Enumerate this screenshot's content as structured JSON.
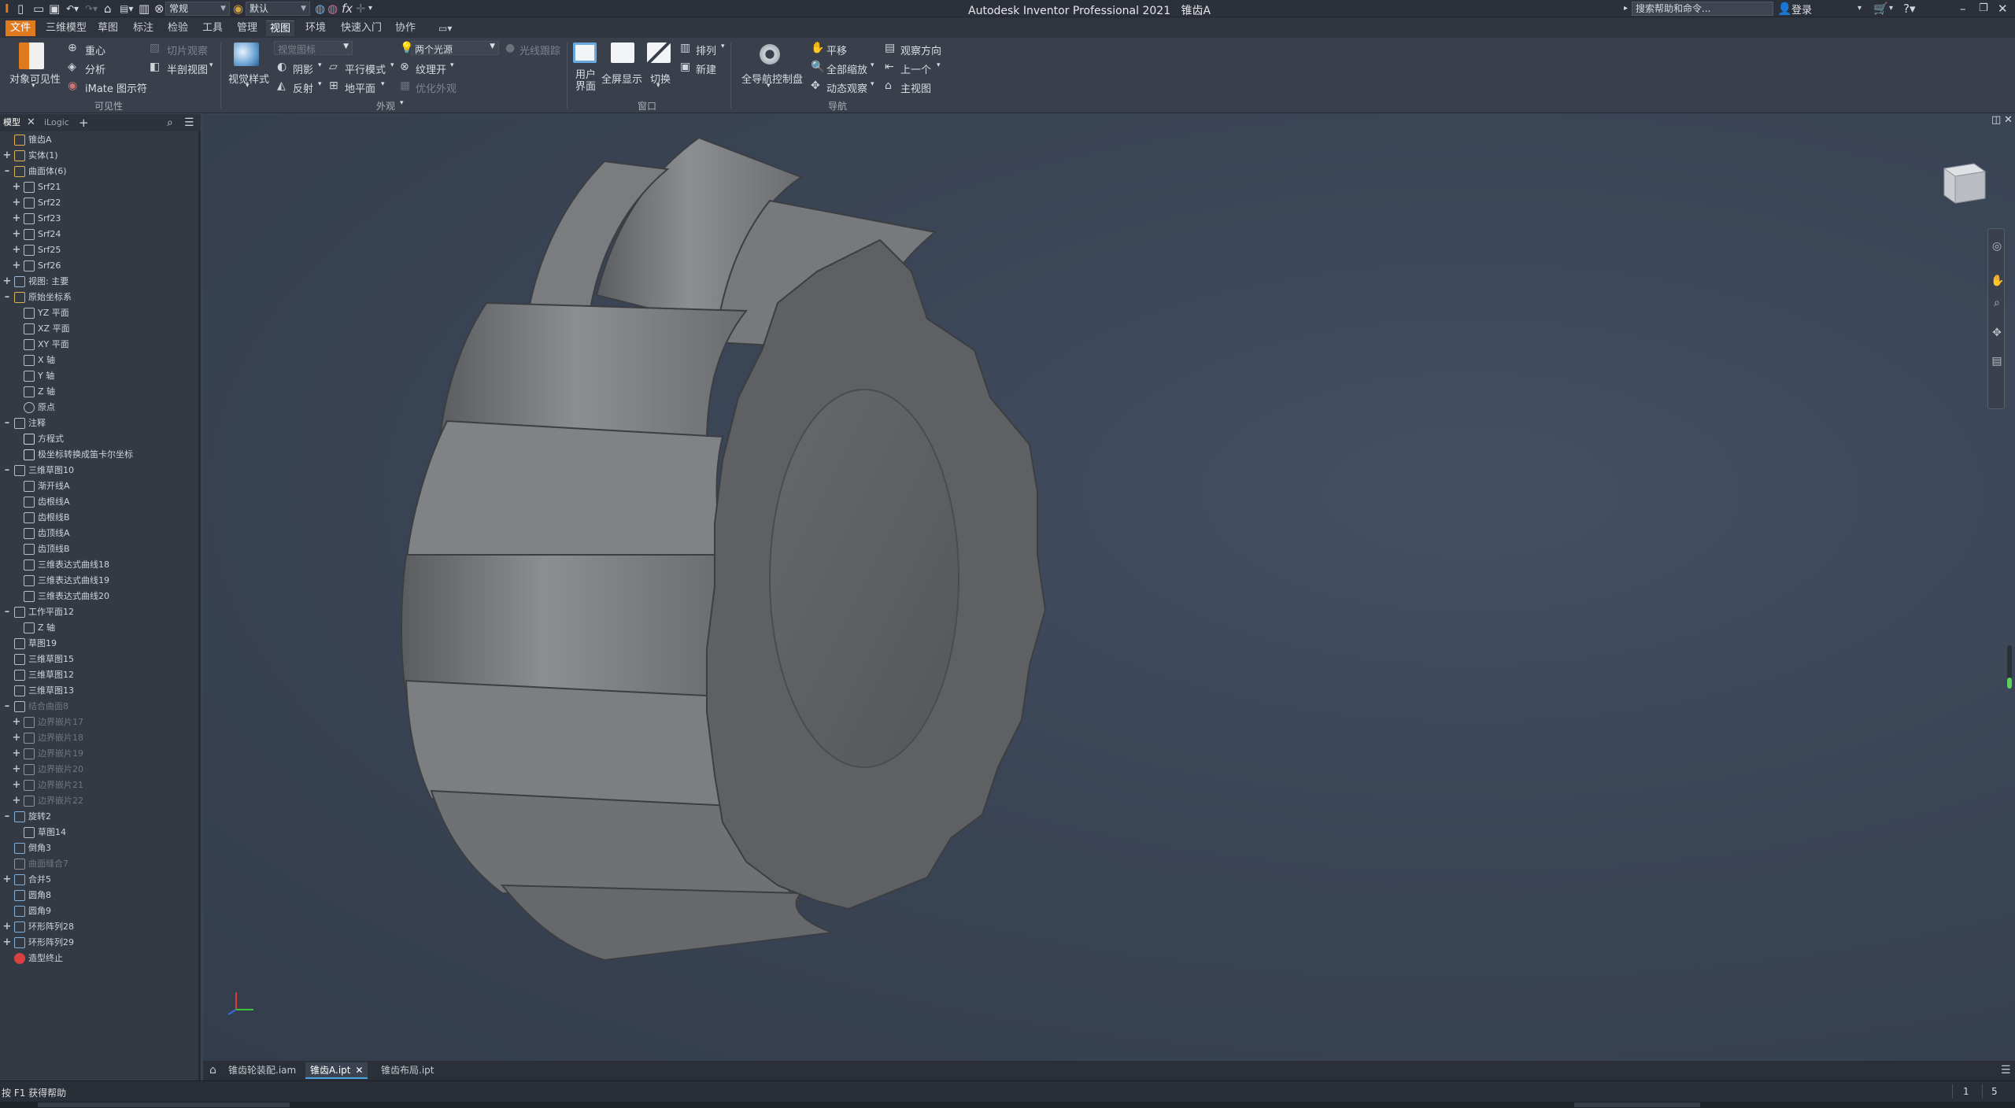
{
  "titlebar": {
    "app_title": "Autodesk Inventor Professional 2021",
    "doc_title": "锥齿A",
    "appearance_combo": "常规",
    "material_combo": "默认",
    "search_placeholder": "搜索帮助和命令...",
    "sign_in": "登录"
  },
  "menu_tabs": [
    "文件",
    "三维模型",
    "草图",
    "标注",
    "检验",
    "工具",
    "管理",
    "视图",
    "环境",
    "快速入门",
    "协作"
  ],
  "ribbon": {
    "visibility": {
      "object_visibility": "对象可见性",
      "center_of_gravity": "重心",
      "analysis": "分析",
      "imate_glyph": "iMate 图示符",
      "slice_graphics": "切片观察",
      "half_section": "半剖视图",
      "group_label": "可见性"
    },
    "appearance": {
      "visual_style": "视觉样式",
      "shadows": "阴影",
      "reflections": "反射",
      "parallel_mode": "平行模式",
      "ground_plane": "地平面",
      "two_lights": "两个光源",
      "textures_on": "纹理开",
      "ray_tracing": "光线跟踪",
      "optimize_appearance": "优化外观",
      "style_combo": "视觉图标",
      "group_label": "外观"
    },
    "windows": {
      "user_interface": "用户界面",
      "full_screen": "全屏显示",
      "switch": "切换",
      "arrange": "排列",
      "new": "新建",
      "group_label": "窗口"
    },
    "navigate": {
      "full_nav_wheel": "全导航控制盘",
      "pan": "平移",
      "zoom_all": "全部缩放",
      "orbit": "动态观察",
      "look_at": "观察方向",
      "previous": "上一个",
      "home_view": "主视图",
      "group_label": "导航"
    }
  },
  "browser": {
    "tab_model": "模型",
    "tab_ilogic": "iLogic",
    "items": [
      {
        "label": "锥齿A",
        "indent": 0,
        "exp": "",
        "icon": "part",
        "dim": false
      },
      {
        "label": "实体(1)",
        "indent": 0,
        "exp": "+",
        "icon": "folder",
        "dim": false
      },
      {
        "label": "曲面体(6)",
        "indent": 0,
        "exp": "-",
        "icon": "folder",
        "dim": false
      },
      {
        "label": "Srf21",
        "indent": 1,
        "exp": "+",
        "icon": "surface",
        "dim": false
      },
      {
        "label": "Srf22",
        "indent": 1,
        "exp": "+",
        "icon": "surface",
        "dim": false
      },
      {
        "label": "Srf23",
        "indent": 1,
        "exp": "+",
        "icon": "surface",
        "dim": false
      },
      {
        "label": "Srf24",
        "indent": 1,
        "exp": "+",
        "icon": "surface",
        "dim": false
      },
      {
        "label": "Srf25",
        "indent": 1,
        "exp": "+",
        "icon": "surface",
        "dim": false
      },
      {
        "label": "Srf26",
        "indent": 1,
        "exp": "+",
        "icon": "surface",
        "dim": false
      },
      {
        "label": "视图: 主要",
        "indent": 0,
        "exp": "+",
        "icon": "view",
        "dim": false
      },
      {
        "label": "原始坐标系",
        "indent": 0,
        "exp": "-",
        "icon": "folder-open",
        "dim": false
      },
      {
        "label": "YZ 平面",
        "indent": 1,
        "exp": "",
        "icon": "plane",
        "dim": false
      },
      {
        "label": "XZ 平面",
        "indent": 1,
        "exp": "",
        "icon": "plane",
        "dim": false
      },
      {
        "label": "XY 平面",
        "indent": 1,
        "exp": "",
        "icon": "plane",
        "dim": false
      },
      {
        "label": "X 轴",
        "indent": 1,
        "exp": "",
        "icon": "axis",
        "dim": false
      },
      {
        "label": "Y 轴",
        "indent": 1,
        "exp": "",
        "icon": "axis",
        "dim": false
      },
      {
        "label": "Z 轴",
        "indent": 1,
        "exp": "",
        "icon": "axis",
        "dim": false
      },
      {
        "label": "原点",
        "indent": 1,
        "exp": "",
        "icon": "point",
        "dim": false
      },
      {
        "label": "注释",
        "indent": 0,
        "exp": "-",
        "icon": "list",
        "dim": false
      },
      {
        "label": "方程式",
        "indent": 1,
        "exp": "",
        "icon": "doc",
        "dim": false
      },
      {
        "label": "极坐标转换成笛卡尔坐标",
        "indent": 1,
        "exp": "",
        "icon": "doc",
        "dim": false
      },
      {
        "label": "三维草图10",
        "indent": 0,
        "exp": "-",
        "icon": "sketch3d",
        "dim": false
      },
      {
        "label": "渐开线A",
        "indent": 1,
        "exp": "",
        "icon": "curve",
        "dim": false
      },
      {
        "label": "齿根线A",
        "indent": 1,
        "exp": "",
        "icon": "curve",
        "dim": false
      },
      {
        "label": "齿根线B",
        "indent": 1,
        "exp": "",
        "icon": "curve",
        "dim": false
      },
      {
        "label": "齿顶线A",
        "indent": 1,
        "exp": "",
        "icon": "curve",
        "dim": false
      },
      {
        "label": "齿顶线B",
        "indent": 1,
        "exp": "",
        "icon": "curve",
        "dim": false
      },
      {
        "label": "三维表达式曲线18",
        "indent": 1,
        "exp": "",
        "icon": "curve",
        "dim": false
      },
      {
        "label": "三维表达式曲线19",
        "indent": 1,
        "exp": "",
        "icon": "curve",
        "dim": false
      },
      {
        "label": "三维表达式曲线20",
        "indent": 1,
        "exp": "",
        "icon": "curve",
        "dim": false
      },
      {
        "label": "工作平面12",
        "indent": 0,
        "exp": "-",
        "icon": "plane",
        "dim": false
      },
      {
        "label": "Z 轴",
        "indent": 1,
        "exp": "",
        "icon": "axis",
        "dim": false
      },
      {
        "label": "草图19",
        "indent": 0,
        "exp": "",
        "icon": "sketch",
        "dim": false
      },
      {
        "label": "三维草图15",
        "indent": 0,
        "exp": "",
        "icon": "sketch3d",
        "dim": false
      },
      {
        "label": "三维草图12",
        "indent": 0,
        "exp": "",
        "icon": "sketch3d",
        "dim": false
      },
      {
        "label": "三维草图13",
        "indent": 0,
        "exp": "",
        "icon": "sketch3d",
        "dim": false
      },
      {
        "label": "结合曲面8",
        "indent": 0,
        "exp": "-",
        "icon": "plane",
        "dim": true
      },
      {
        "label": "边界嵌片17",
        "indent": 1,
        "exp": "+",
        "icon": "patch",
        "dim": true
      },
      {
        "label": "边界嵌片18",
        "indent": 1,
        "exp": "+",
        "icon": "patch",
        "dim": true
      },
      {
        "label": "边界嵌片19",
        "indent": 1,
        "exp": "+",
        "icon": "patch",
        "dim": true
      },
      {
        "label": "边界嵌片20",
        "indent": 1,
        "exp": "+",
        "icon": "patch",
        "dim": true
      },
      {
        "label": "边界嵌片21",
        "indent": 1,
        "exp": "+",
        "icon": "patch",
        "dim": true
      },
      {
        "label": "边界嵌片22",
        "indent": 1,
        "exp": "+",
        "icon": "patch",
        "dim": true
      },
      {
        "label": "旋转2",
        "indent": 0,
        "exp": "-",
        "icon": "revolve",
        "dim": false
      },
      {
        "label": "草图14",
        "indent": 1,
        "exp": "",
        "icon": "sketch",
        "dim": false
      },
      {
        "label": "倒角3",
        "indent": 0,
        "exp": "",
        "icon": "chamfer",
        "dim": false
      },
      {
        "label": "曲面缝合7",
        "indent": 0,
        "exp": "",
        "icon": "stitch",
        "dim": true
      },
      {
        "label": "合并5",
        "indent": 0,
        "exp": "+",
        "icon": "combine",
        "dim": false
      },
      {
        "label": "圆角8",
        "indent": 0,
        "exp": "",
        "icon": "fillet",
        "dim": false
      },
      {
        "label": "圆角9",
        "indent": 0,
        "exp": "",
        "icon": "fillet",
        "dim": false
      },
      {
        "label": "环形阵列28",
        "indent": 0,
        "exp": "+",
        "icon": "pattern",
        "dim": false
      },
      {
        "label": "环形阵列29",
        "indent": 0,
        "exp": "+",
        "icon": "pattern",
        "dim": false
      },
      {
        "label": "造型终止",
        "indent": 0,
        "exp": "",
        "icon": "end",
        "dim": false
      }
    ]
  },
  "doc_tabs": [
    {
      "label": "锥齿轮装配.iam",
      "active": false,
      "closable": false
    },
    {
      "label": "锥齿A.ipt",
      "active": true,
      "closable": true
    },
    {
      "label": "锥齿布局.ipt",
      "active": false,
      "closable": false
    }
  ],
  "status": {
    "help_text": "按 F1 获得帮助",
    "count_a": "1",
    "count_b": "5"
  },
  "colors": {
    "accent_file_tab": "#e07a1e",
    "viewport_bg": "#3a4556",
    "model_gray": "#6e7074",
    "active_tab_underline": "#4aa3df"
  }
}
